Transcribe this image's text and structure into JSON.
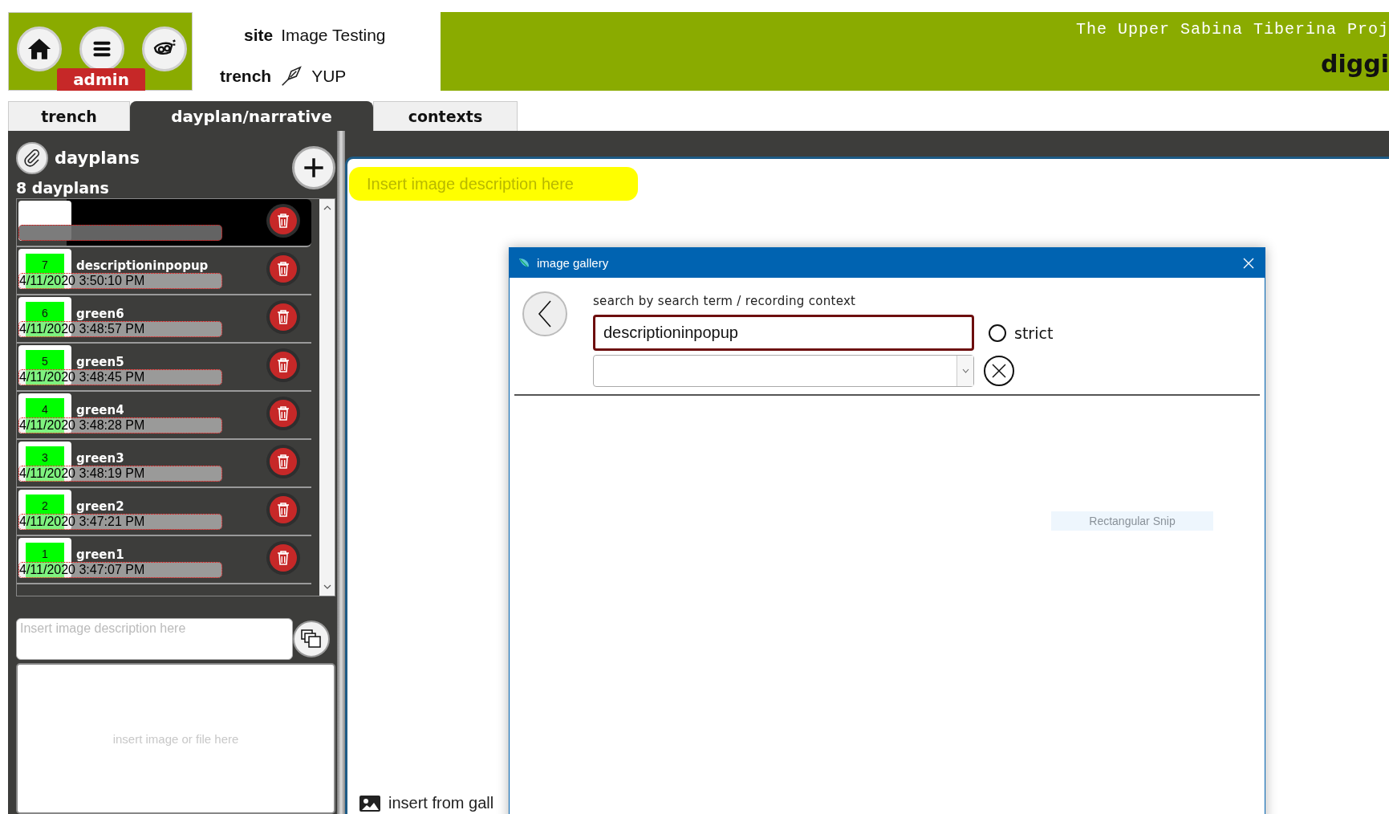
{
  "header": {
    "user_role": "admin",
    "site_label": "site",
    "site": "Image Testing",
    "trench_label": "trench",
    "trench": "YUP",
    "project_title": "The Upper Sabina Tiberina Proj",
    "app_title": "diggi"
  },
  "tabs": [
    {
      "label": "trench",
      "selected": false
    },
    {
      "label": "dayplan/narrative",
      "selected": true
    },
    {
      "label": "contexts",
      "selected": false
    }
  ],
  "dayplans": {
    "title": "dayplans",
    "count": "8 dayplans",
    "items": [
      {
        "selected": true
      },
      {
        "number": "7",
        "name": "descriptioninpopup",
        "date": "4/11/2020 3:50:10 PM",
        "selected": false
      },
      {
        "number": "6",
        "name": "green6",
        "date": "4/11/2020 3:48:57 PM",
        "selected": false
      },
      {
        "number": "5",
        "name": "green5",
        "date": "4/11/2020 3:48:45 PM",
        "selected": false
      },
      {
        "number": "4",
        "name": "green4",
        "date": "4/11/2020 3:48:28 PM",
        "selected": false
      },
      {
        "number": "3",
        "name": "green3",
        "date": "4/11/2020 3:48:19 PM",
        "selected": false
      },
      {
        "number": "2",
        "name": "green2",
        "date": "4/11/2020 3:47:21 PM",
        "selected": false
      },
      {
        "number": "1",
        "name": "green1",
        "date": "4/11/2020 3:47:07 PM",
        "selected": false
      }
    ]
  },
  "description_field": {
    "placeholder": "Insert image description here"
  },
  "drop_area": {
    "hint": "insert image or file here"
  },
  "narrative": {
    "description_field": {
      "placeholder": "Insert image description here"
    },
    "gallery_link": "insert from gall"
  },
  "dialog": {
    "title": "image gallery",
    "search_label": "search by search term / recording context",
    "search_field": {
      "value": "descriptioninpopup"
    },
    "strict": {
      "label": "strict",
      "checked": false
    },
    "tooltip": "Rectangular Snip"
  }
}
